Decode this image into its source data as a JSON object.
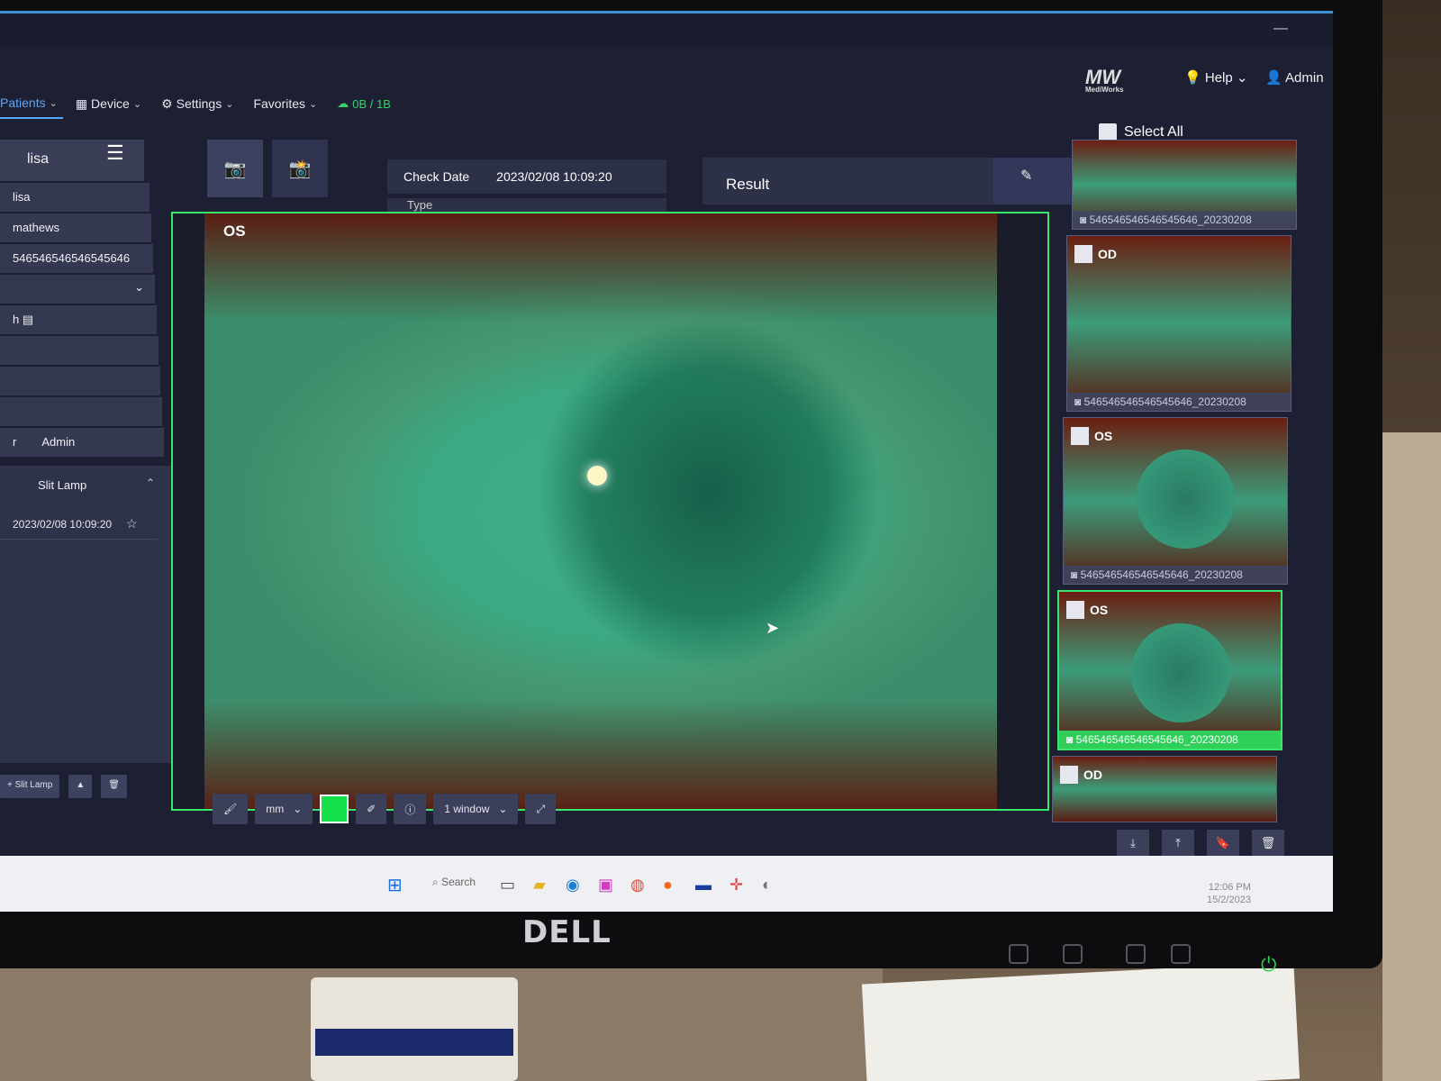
{
  "app": {
    "logo_text": "MediWorks",
    "nav": {
      "patients": "Patients",
      "device": "Device",
      "settings": "Settings",
      "favorites": "Favorites",
      "storage": "0B / 1B"
    },
    "help": "Help",
    "admin": "Admin"
  },
  "left_panel": {
    "patient_header": "lisa",
    "first_name": "lisa",
    "last_name": "mathews",
    "patient_id": "546546546546545646",
    "operator_label": "r",
    "operator_value": "Admin",
    "dob_prefix": "h",
    "section_title": "Slit Lamp",
    "record_date": "2023/02/08 10:09:20",
    "bottom_add": "+ Slit Lamp"
  },
  "info": {
    "check_date_label": "Check Date",
    "check_date_value": "2023/02/08 10:09:20",
    "type_label": "Type",
    "result_label": "Result"
  },
  "viewer": {
    "eye": "OS"
  },
  "toolbar": {
    "unit": "mm",
    "window_select": "1 window",
    "swatch_color": "#16e14a"
  },
  "right_panel": {
    "select_all": "Select All",
    "thumbs": [
      {
        "eye": "",
        "caption": "546546546546545646_20230208"
      },
      {
        "eye": "OD",
        "caption": "546546546546545646_20230208"
      },
      {
        "eye": "OS",
        "caption": "546546546546545646_20230208"
      },
      {
        "eye": "OS",
        "caption": "546546546546545646_20230208"
      },
      {
        "eye": "OD",
        "caption": ""
      }
    ]
  },
  "taskbar": {
    "search": "Search",
    "time": "12:06 PM",
    "date": "15/2/2023"
  },
  "monitor": {
    "brand": "DELL"
  },
  "colors": {
    "accent_blue": "#5aa7ff",
    "selection_green": "#39e86b",
    "storage_green": "#34d36a"
  }
}
